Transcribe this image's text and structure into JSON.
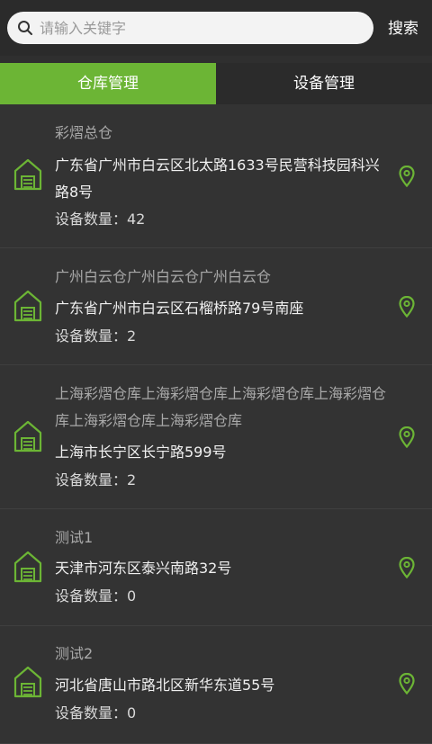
{
  "search": {
    "placeholder": "请输入关键字",
    "button": "搜索"
  },
  "tabs": [
    {
      "label": "仓库管理",
      "active": true
    },
    {
      "label": "设备管理",
      "active": false
    }
  ],
  "colors": {
    "accent": "#6cb535",
    "background": "#2f2f2f"
  },
  "warehouses": [
    {
      "name": "彩熠总仓",
      "address": "广东省广州市白云区北太路1633号民营科技园科兴路8号",
      "device_count": "设备数量：42"
    },
    {
      "name": "广州白云仓广州白云仓广州白云仓",
      "address": "广东省广州市白云区石榴桥路79号南座",
      "device_count": "设备数量：2"
    },
    {
      "name": "上海彩熠仓库上海彩熠仓库上海彩熠仓库上海彩熠仓库上海彩熠仓库上海彩熠仓库",
      "address": "上海市长宁区长宁路599号",
      "device_count": "设备数量：2"
    },
    {
      "name": "测试1",
      "address": "天津市河东区泰兴南路32号",
      "device_count": "设备数量：0"
    },
    {
      "name": "测试2",
      "address": "河北省唐山市路北区新华东道55号",
      "device_count": "设备数量：0"
    }
  ]
}
